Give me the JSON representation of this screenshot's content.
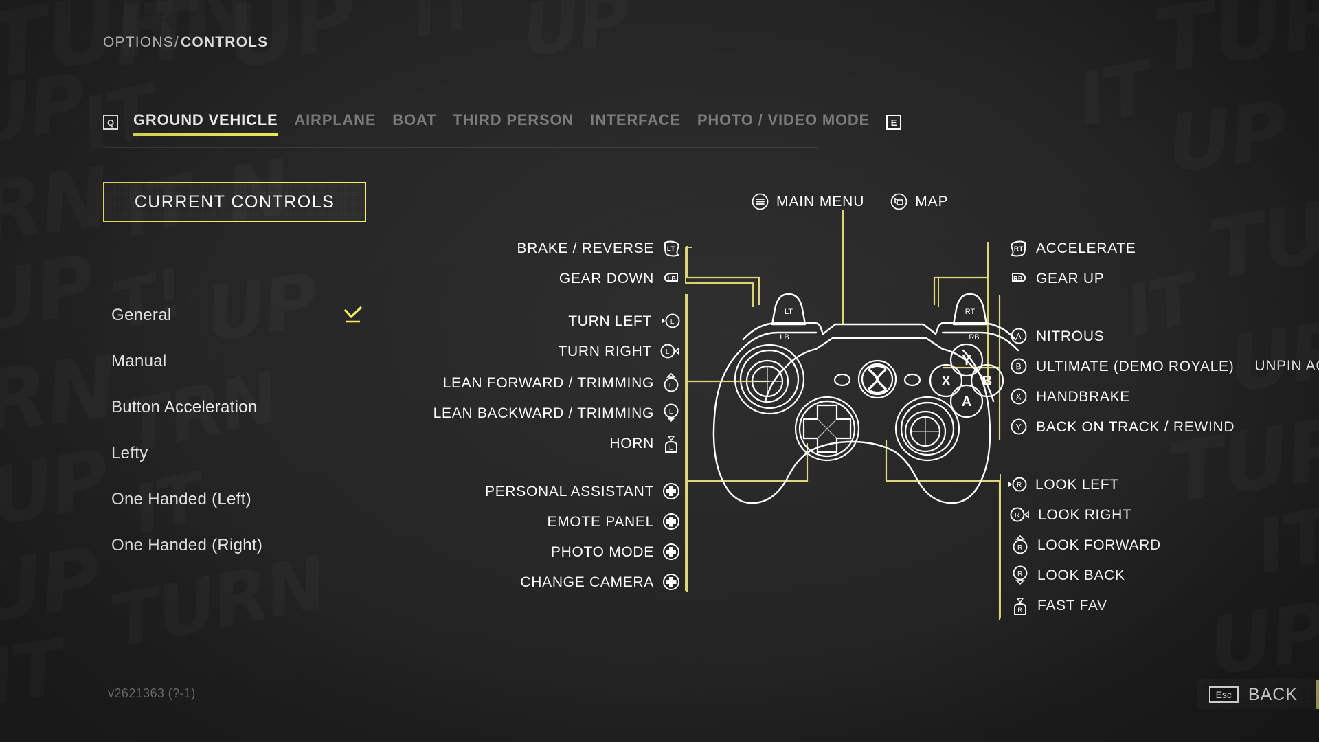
{
  "theme": {
    "accent": "#f3ef5e",
    "background": "#242424",
    "text": "#ffffff",
    "muted_text": "#7b7b7b"
  },
  "header": {
    "breadcrumb_parent": "OPTIONS",
    "breadcrumb_separator": "/",
    "breadcrumb_current": "CONTROLS"
  },
  "tabs": {
    "prev_key": "Q",
    "next_key": "E",
    "items": [
      {
        "label": "GROUND VEHICLE",
        "active": true
      },
      {
        "label": "AIRPLANE",
        "active": false
      },
      {
        "label": "BOAT",
        "active": false
      },
      {
        "label": "THIRD PERSON",
        "active": false
      },
      {
        "label": "INTERFACE",
        "active": false
      },
      {
        "label": "PHOTO / VIDEO MODE",
        "active": false
      }
    ]
  },
  "sidebar": {
    "current_controls_label": "CURRENT CONTROLS",
    "presets": [
      {
        "label": "General",
        "selected": true
      },
      {
        "label": "Manual",
        "selected": false
      },
      {
        "label": "Button Acceleration",
        "selected": false
      },
      {
        "label": "Lefty",
        "selected": false
      },
      {
        "label": "One Handed (Left)",
        "selected": false
      },
      {
        "label": "One Handed (Right)",
        "selected": false
      }
    ]
  },
  "controller": {
    "trigger_left_label": "LT",
    "trigger_right_label": "RT",
    "bumper_left_label": "LB",
    "bumper_right_label": "RB",
    "face_buttons": [
      "Y",
      "X",
      "B",
      "A"
    ],
    "guide_label": "Xbox"
  },
  "top_center_bindings": [
    {
      "icon": "menu-icon",
      "label": "MAIN MENU"
    },
    {
      "icon": "map-icon",
      "label": "MAP"
    }
  ],
  "left_bindings": [
    {
      "label": "BRAKE / REVERSE",
      "icon": "trigger-lt-icon"
    },
    {
      "label": "GEAR DOWN",
      "icon": "bumper-lb-icon"
    },
    {
      "label": "TURN LEFT",
      "icon": "lstick-left-icon"
    },
    {
      "label": "TURN RIGHT",
      "icon": "lstick-right-icon"
    },
    {
      "label": "LEAN FORWARD / TRIMMING",
      "icon": "lstick-up-icon"
    },
    {
      "label": "LEAN BACKWARD / TRIMMING",
      "icon": "lstick-down-icon"
    },
    {
      "label": "HORN",
      "icon": "lstick-press-icon"
    },
    {
      "label": "PERSONAL ASSISTANT",
      "icon": "dpad-up-icon"
    },
    {
      "label": "EMOTE PANEL",
      "icon": "dpad-down-icon"
    },
    {
      "label": "PHOTO MODE",
      "icon": "dpad-left-icon"
    },
    {
      "label": "CHANGE CAMERA",
      "icon": "dpad-right-icon"
    }
  ],
  "right_bindings": [
    {
      "label": "ACCELERATE",
      "icon": "trigger-rt-icon",
      "extra": ""
    },
    {
      "label": "GEAR UP",
      "icon": "bumper-rb-icon",
      "extra": ""
    },
    {
      "label": "NITROUS",
      "icon": "button-a-icon",
      "extra": ""
    },
    {
      "label": "ULTIMATE (DEMO ROYALE)",
      "icon": "button-b-icon",
      "extra": "UNPIN ACT"
    },
    {
      "label": "HANDBRAKE",
      "icon": "button-x-icon",
      "extra": ""
    },
    {
      "label": "BACK ON TRACK / REWIND",
      "icon": "button-y-icon",
      "extra": ""
    },
    {
      "label": "LOOK LEFT",
      "icon": "rstick-left-icon",
      "extra": ""
    },
    {
      "label": "LOOK RIGHT",
      "icon": "rstick-right-icon",
      "extra": ""
    },
    {
      "label": "LOOK FORWARD",
      "icon": "rstick-up-icon",
      "extra": ""
    },
    {
      "label": "LOOK BACK",
      "icon": "rstick-down-icon",
      "extra": ""
    },
    {
      "label": "FAST FAV",
      "icon": "rstick-press-icon",
      "extra": ""
    }
  ],
  "footer": {
    "version": "v2621363 (?-1)",
    "back_key": "Esc",
    "back_label": "BACK"
  },
  "background_graffiti": [
    "TURN",
    "IT",
    "UP",
    "TURN",
    "IT",
    "UP",
    "TURN",
    "IT",
    "UP",
    "TURN",
    "IT",
    "UP"
  ]
}
